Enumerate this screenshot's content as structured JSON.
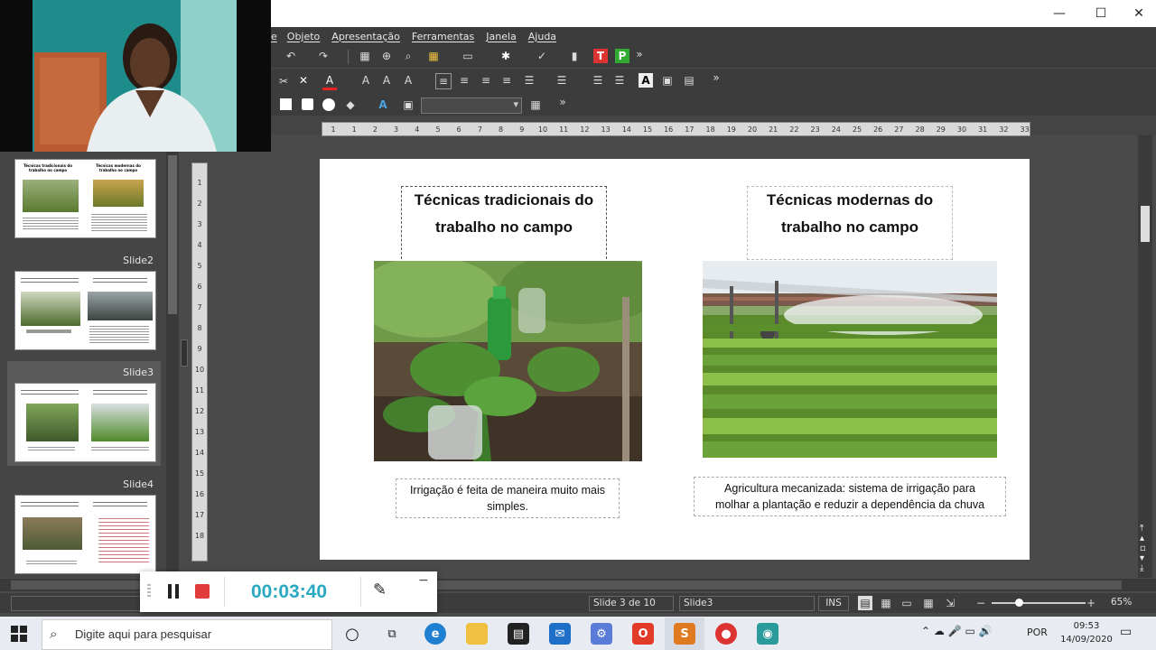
{
  "menubar": {
    "items": [
      "e",
      "Objeto",
      "Apresentação",
      "Ferramentas",
      "Janela",
      "Ajuda"
    ]
  },
  "window_controls": {
    "minimize": "—",
    "maximize": "☐",
    "close": "✕"
  },
  "toolbar": {
    "font_box_value": ""
  },
  "ruler": {
    "h_ticks": [
      "1",
      "1",
      "2",
      "3",
      "4",
      "5",
      "6",
      "7",
      "8",
      "9",
      "10",
      "11",
      "12",
      "13",
      "14",
      "15",
      "16",
      "17",
      "18",
      "19",
      "20",
      "21",
      "22",
      "23",
      "24",
      "25",
      "26",
      "27",
      "28",
      "29",
      "30",
      "31",
      "32",
      "33"
    ],
    "v_ticks": [
      "1",
      "2",
      "3",
      "4",
      "5",
      "6",
      "7",
      "8",
      "9",
      "10",
      "11",
      "12",
      "13",
      "14",
      "15",
      "16",
      "17",
      "18"
    ]
  },
  "slide_panel": {
    "labels": [
      "Slide2",
      "Slide3",
      "Slide4"
    ],
    "thumb_titles": {
      "t1_left": "Técnicas tradicionais do trabalho no campo",
      "t1_right": "Técnicas modernas do trabalho no campo"
    }
  },
  "slide": {
    "left_title_line1": "Técnicas tradicionais do",
    "left_title_line2": "trabalho no campo",
    "right_title_line1": "Técnicas modernas do",
    "right_title_line2": "trabalho no campo",
    "left_caption_line1": "Irrigação é feita de maneira muito mais",
    "left_caption_line2": "simples.",
    "right_caption_line1": "Agricultura mecanizada: sistema de irrigação  para",
    "right_caption_line2": "molhar a plantação e reduzir a dependência da chuva"
  },
  "statusbar": {
    "slide_pos": "Slide 3 de 10",
    "layout": "Slide3",
    "mode": "INS",
    "zoom": "65%"
  },
  "recorder": {
    "time": "00:03:40"
  },
  "taskbar": {
    "search_placeholder": "Digite aqui para pesquisar",
    "lang": "POR",
    "time": "09:53",
    "date": "14/09/2020"
  },
  "colors": {
    "accent_teal": "#2aa9c0",
    "record_red": "#e23b3b",
    "dark_ui": "#3c3c3c"
  }
}
